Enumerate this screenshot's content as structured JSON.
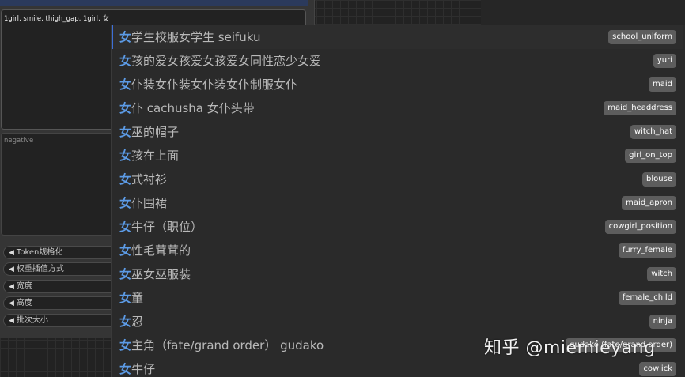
{
  "prompt": {
    "value": "1girl, smile, thigh_gap, 1girl, 女"
  },
  "negative": {
    "placeholder": "negative"
  },
  "widgets": [
    {
      "label": "Token规格化"
    },
    {
      "label": "权重插值方式"
    },
    {
      "label": "宽度"
    },
    {
      "label": "高度"
    },
    {
      "label": "批次大小"
    }
  ],
  "autocomplete": {
    "highlight_char": "女",
    "items": [
      {
        "rest": "学生校服女学生 seifuku",
        "tag": "school_uniform"
      },
      {
        "rest": "孩的爱女孩爱女孩爱女同性恋少女爱",
        "tag": "yuri"
      },
      {
        "rest": "仆装女仆装女仆装女仆制服女仆",
        "tag": "maid"
      },
      {
        "rest": "仆 cachusha 女仆头带",
        "tag": "maid_headdress"
      },
      {
        "rest": "巫的帽子",
        "tag": "witch_hat"
      },
      {
        "rest": "孩在上面",
        "tag": "girl_on_top"
      },
      {
        "rest": "式衬衫",
        "tag": "blouse"
      },
      {
        "rest": "仆围裙",
        "tag": "maid_apron"
      },
      {
        "rest": "牛仔（职位）",
        "tag": "cowgirl_position"
      },
      {
        "rest": "性毛茸茸的",
        "tag": "furry_female"
      },
      {
        "rest": "巫女巫服装",
        "tag": "witch"
      },
      {
        "rest": "童",
        "tag": "female_child"
      },
      {
        "rest": "忍",
        "tag": "ninja"
      },
      {
        "rest": "主角（fate/grand order） gudako",
        "tag": "gudako (fate/grand order)"
      },
      {
        "rest": "牛仔",
        "tag": "cowlick"
      }
    ]
  },
  "watermark": "知乎 @miemieyang",
  "colors": {
    "highlight": "#5c9be6",
    "selected_border": "#3d6fd8",
    "badge_bg": "#5d5d5d"
  }
}
